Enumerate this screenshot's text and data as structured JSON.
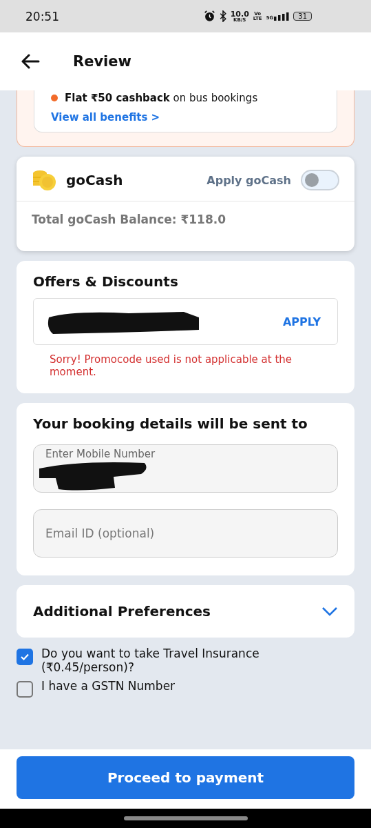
{
  "status_bar": {
    "time": "20:51",
    "net_speed": "10.0",
    "net_unit": "KB/S",
    "volte": "Vo",
    "lte": "LTE",
    "network": "5G",
    "battery": "31"
  },
  "header": {
    "title": "Review"
  },
  "benefits": {
    "items": [
      "**Flat ₹50 cashback** on bus bookings"
    ],
    "link": "View all benefits >"
  },
  "gocash": {
    "title": "goCash",
    "toggle_label": "Apply goCash",
    "on": false,
    "balance": "Total goCash Balance: ₹118.0"
  },
  "offers": {
    "title": "Offers & Discounts",
    "action": "APPLY",
    "error": "Sorry! Promocode used is not applicable at the moment."
  },
  "contact": {
    "title": "Your booking details will be sent to",
    "mobile_label": "Enter Mobile Number",
    "email_placeholder": "Email ID (optional)"
  },
  "preferences": {
    "title": "Additional Preferences",
    "expanded": false
  },
  "options": [
    {
      "label": "Do you want to take Travel Insurance (₹0.45/person)?",
      "checked": true
    },
    {
      "label": "I have a GSTN Number",
      "checked": false
    }
  ],
  "primary_button": "Proceed to payment"
}
